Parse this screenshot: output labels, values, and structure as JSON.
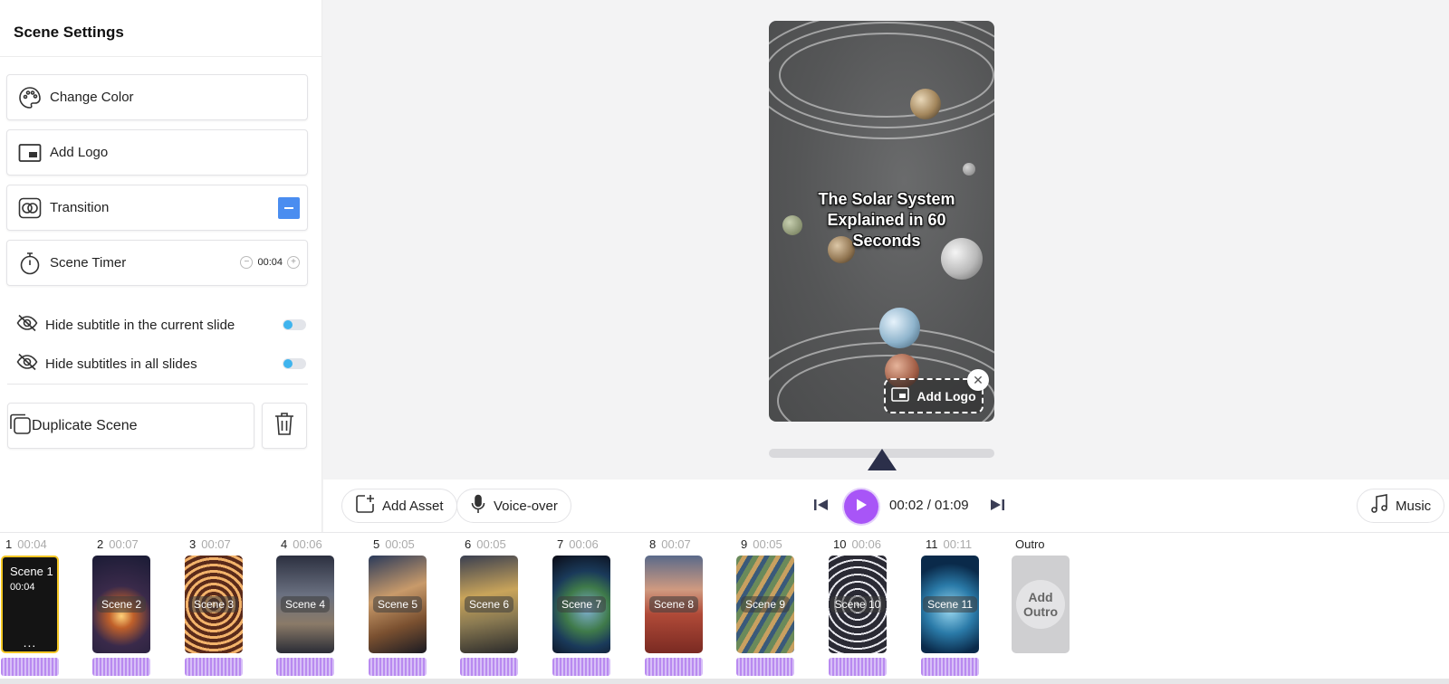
{
  "sidebar": {
    "title": "Scene Settings",
    "change_color": "Change Color",
    "add_logo": "Add Logo",
    "transition": "Transition",
    "scene_timer": "Scene Timer",
    "scene_timer_value": "00:04",
    "hide_subtitle_current": "Hide subtitle in the current slide",
    "hide_subtitles_all": "Hide subtitles in all slides",
    "duplicate_scene": "Duplicate Scene"
  },
  "preview": {
    "title": "The Solar System Explained in 60 Seconds",
    "add_logo": "Add Logo"
  },
  "toolbar": {
    "add_asset": "Add Asset",
    "voice_over": "Voice-over",
    "time": "00:02 / 01:09",
    "music": "Music"
  },
  "timeline": {
    "scene1": {
      "number": "1",
      "duration": "00:04",
      "title": "Scene 1",
      "time": "00:04",
      "more": "..."
    },
    "scenes": [
      {
        "number": "2",
        "duration": "00:07",
        "label": "Scene 2"
      },
      {
        "number": "3",
        "duration": "00:07",
        "label": "Scene 3"
      },
      {
        "number": "4",
        "duration": "00:06",
        "label": "Scene 4"
      },
      {
        "number": "5",
        "duration": "00:05",
        "label": "Scene 5"
      },
      {
        "number": "6",
        "duration": "00:05",
        "label": "Scene 6"
      },
      {
        "number": "7",
        "duration": "00:06",
        "label": "Scene 7"
      },
      {
        "number": "8",
        "duration": "00:07",
        "label": "Scene 8"
      },
      {
        "number": "9",
        "duration": "00:05",
        "label": "Scene 9"
      },
      {
        "number": "10",
        "duration": "00:06",
        "label": "Scene 10"
      },
      {
        "number": "11",
        "duration": "00:11",
        "label": "Scene 11"
      }
    ],
    "outro": {
      "header": "Outro",
      "label": "Add Outro"
    }
  },
  "colors": {
    "accent": "#a855f7",
    "toggle": "#3fb4ee",
    "minus_button": "#4a8df0",
    "selected_border": "#f3c623"
  }
}
